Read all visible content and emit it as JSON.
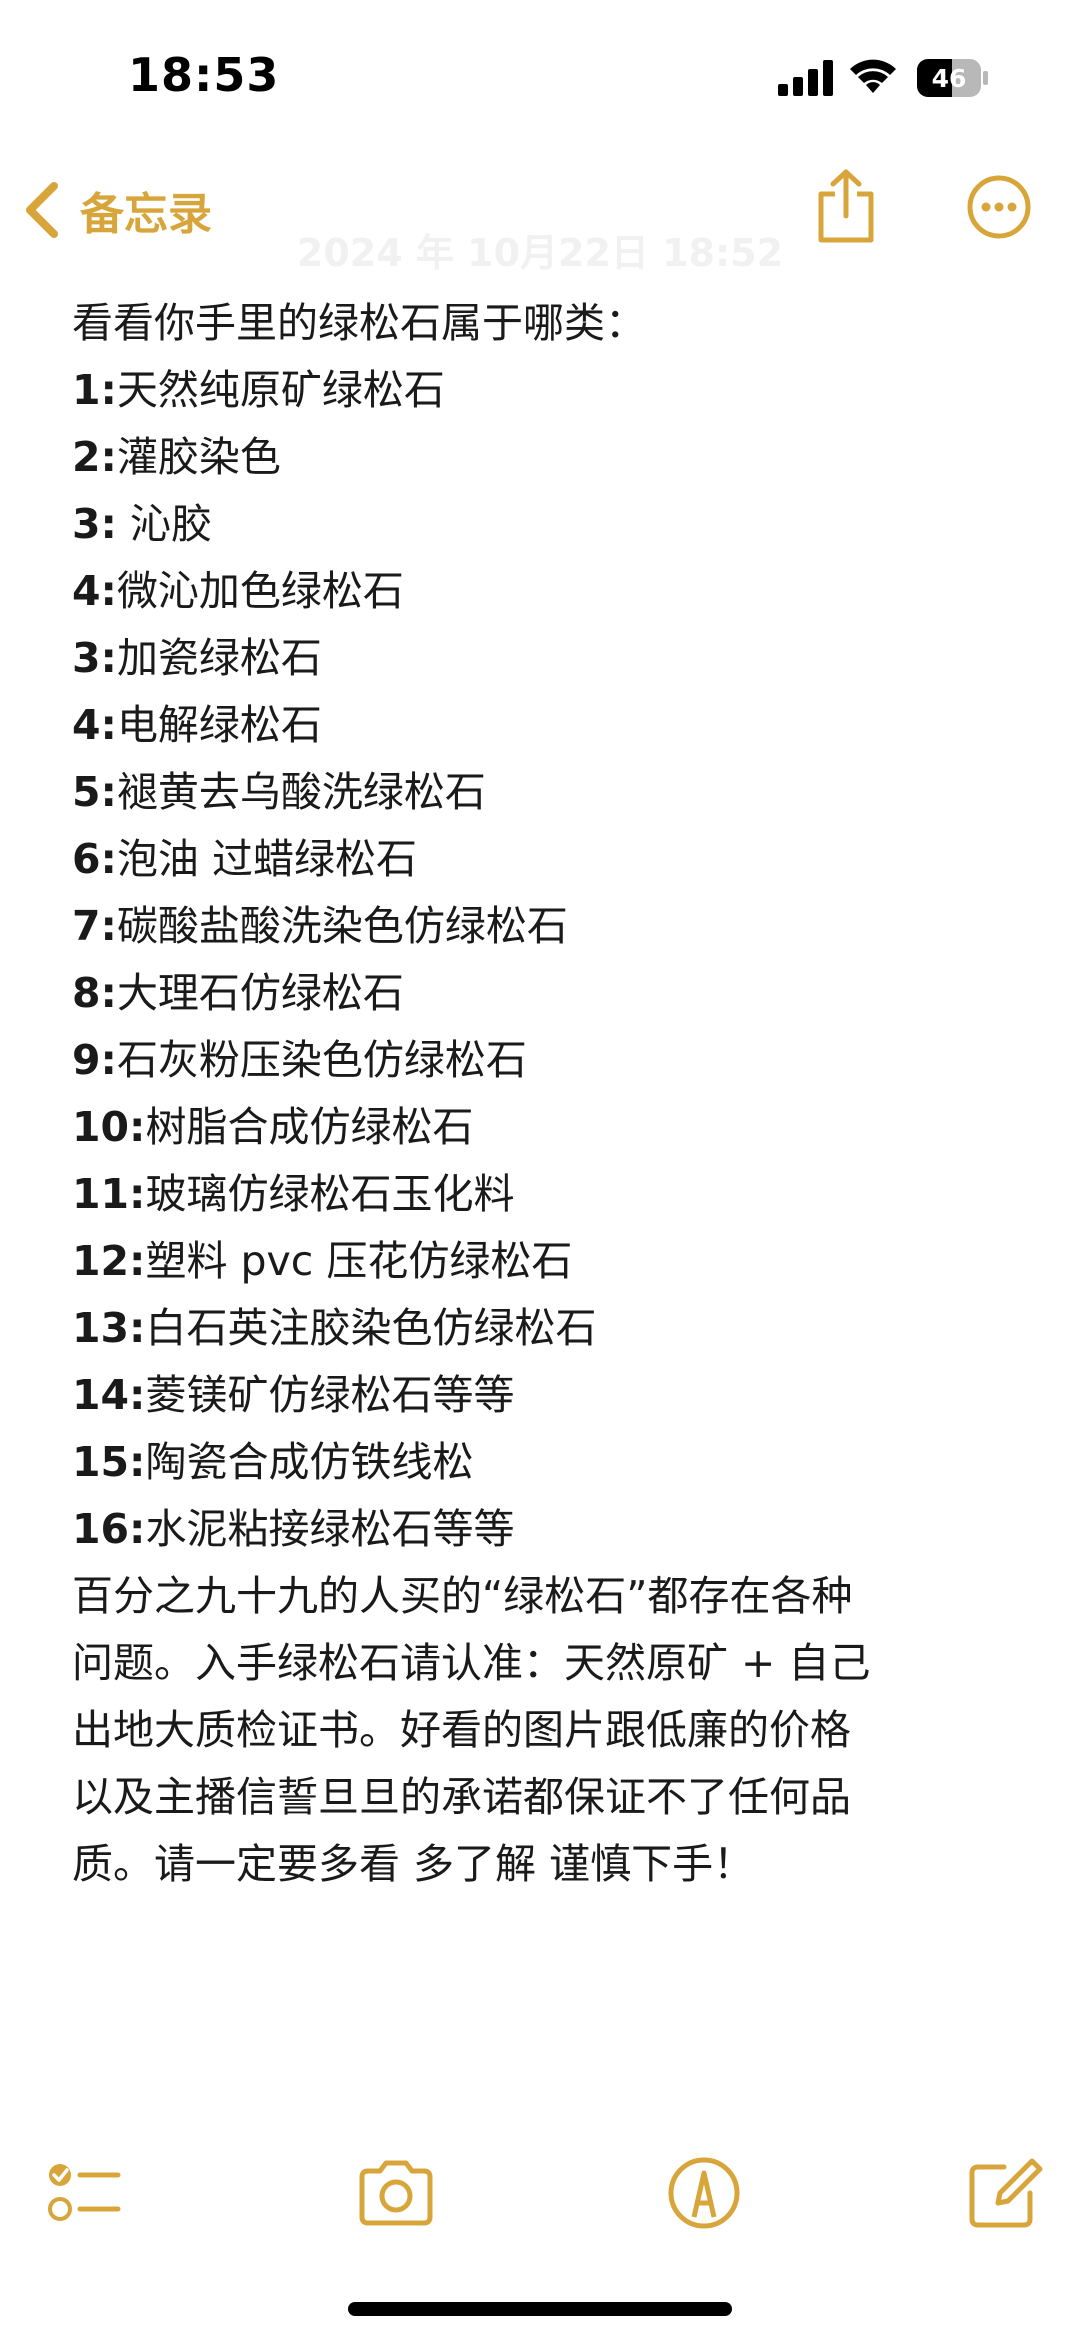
{
  "status_bar": {
    "time": "18:53",
    "battery_level": "46",
    "icons": [
      "signal-icon",
      "wifi-icon",
      "battery-icon"
    ]
  },
  "nav": {
    "back_label": "备忘录",
    "date": "2024 年 10月22日 18:52",
    "icons": [
      "chevron-left-icon",
      "share-icon",
      "more-icon"
    ]
  },
  "note": {
    "heading": "看看你手里的绿松石属于哪类：",
    "items": [
      {
        "num": "1:",
        "text": "天然纯原矿绿松石"
      },
      {
        "num": "2:",
        "text": "灌胶染色"
      },
      {
        "num": "3:",
        "text": " 沁胶"
      },
      {
        "num": "4:",
        "text": "微沁加色绿松石"
      },
      {
        "num": "3:",
        "text": "加瓷绿松石"
      },
      {
        "num": "4:",
        "text": "电解绿松石"
      },
      {
        "num": "5:",
        "text": "褪黄去乌酸洗绿松石"
      },
      {
        "num": "6:",
        "text": "泡油 过蜡绿松石"
      },
      {
        "num": "7:",
        "text": "碳酸盐酸洗染色仿绿松石"
      },
      {
        "num": "8:",
        "text": "大理石仿绿松石"
      },
      {
        "num": "9:",
        "text": "石灰粉压染色仿绿松石"
      },
      {
        "num": "10:",
        "text": "树脂合成仿绿松石"
      },
      {
        "num": "11:",
        "text": "玻璃仿绿松石玉化料"
      },
      {
        "num": "12:",
        "text": "塑料 pvc 压花仿绿松石"
      },
      {
        "num": "13:",
        "text": "白石英注胶染色仿绿松石"
      },
      {
        "num": "14:",
        "text": "菱镁矿仿绿松石等等"
      },
      {
        "num": "15:",
        "text": "陶瓷合成仿铁线松"
      },
      {
        "num": "16:",
        "text": "水泥粘接绿松石等等"
      }
    ],
    "closing_lines": [
      "百分之九十九的人买的“绿松石”都存在各种",
      "问题。入手绿松石请认准：天然原矿 + 自己",
      "出地大质检证书。好看的图片跟低廉的价格",
      "以及主播信誓旦旦的承诺都保证不了任何品",
      "质。请一定要多看 多了解 谨慎下手！"
    ]
  },
  "toolbar": {
    "icons": [
      "checklist-icon",
      "camera-icon",
      "markup-icon",
      "compose-icon"
    ]
  },
  "colors": {
    "accent": "#d8a53a",
    "text": "#1a1a1a",
    "background": "#ffffff"
  }
}
